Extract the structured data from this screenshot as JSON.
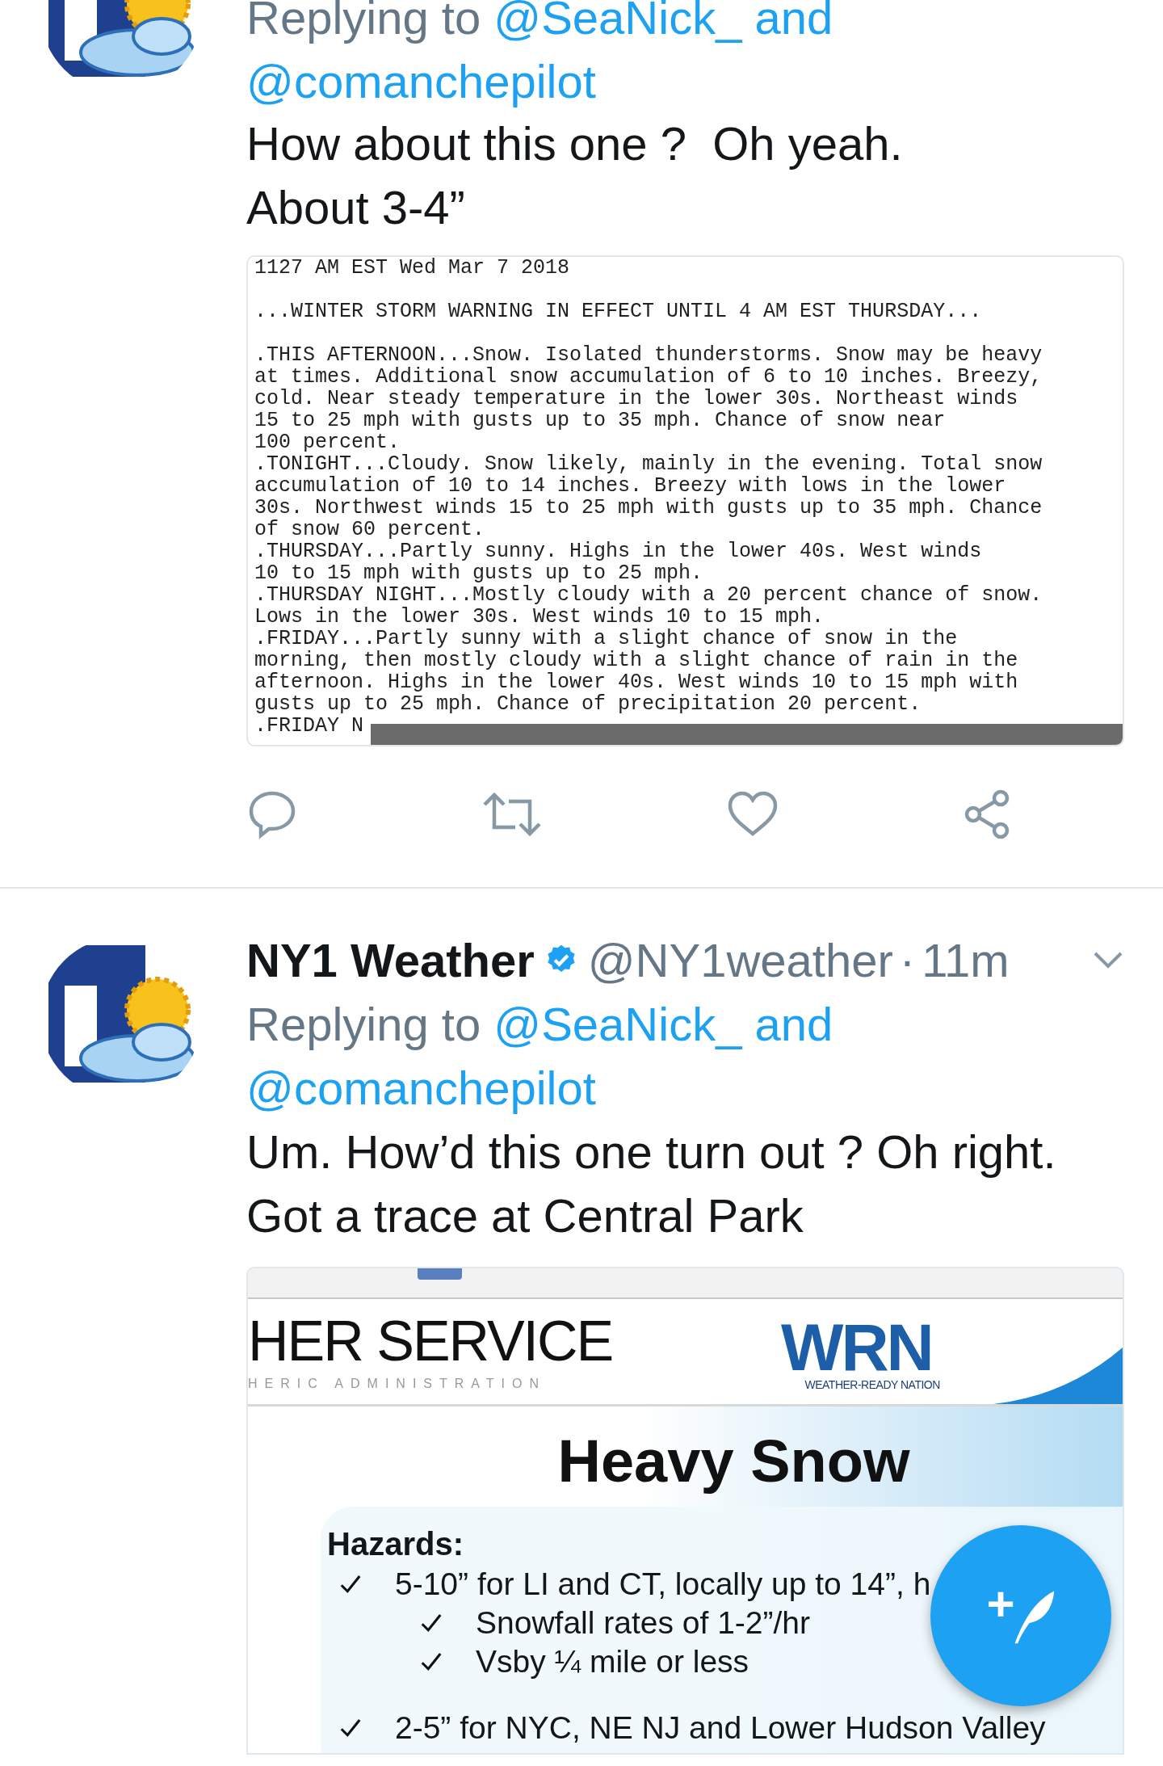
{
  "tweets": [
    {
      "reply": {
        "prefix": "Replying to",
        "mentions": [
          "@SeaNick_ and",
          "@comanchepilot"
        ]
      },
      "text": "How about this one ?  Oh yeah. About 3-4”",
      "attachment": {
        "kind": "document",
        "paragraphs": [
          [
            "1127 AM EST Wed Mar 7 2018"
          ],
          [
            "...WINTER STORM WARNING IN EFFECT UNTIL 4 AM EST THURSDAY..."
          ],
          [
            ".THIS AFTERNOON...Snow. Isolated thunderstorms. Snow may be heavy",
            "at times. Additional snow accumulation of 6 to 10 inches. Breezy,",
            "cold. Near steady temperature in the lower 30s. Northeast winds",
            "15 to 25 mph with gusts up to 35 mph. Chance of snow near",
            "100 percent.",
            ".TONIGHT...Cloudy. Snow likely, mainly in the evening. Total snow",
            "accumulation of 10 to 14 inches. Breezy with lows in the lower",
            "30s. Northwest winds 15 to 25 mph with gusts up to 35 mph. Chance",
            "of snow 60 percent.",
            ".THURSDAY...Partly sunny. Highs in the lower 40s. West winds",
            "10 to 15 mph with gusts up to 25 mph.",
            ".THURSDAY NIGHT...Mostly cloudy with a 20 percent chance of snow.",
            "Lows in the lower 30s. West winds 10 to 15 mph.",
            ".FRIDAY...Partly sunny with a slight chance of snow in the",
            "morning, then mostly cloudy with a slight chance of rain in the",
            "afternoon. Highs in the lower 40s. West winds 10 to 15 mph with",
            "gusts up to 25 mph. Chance of precipitation 20 percent.",
            ".FRIDAY N"
          ]
        ]
      },
      "actions": [
        {
          "kind": "reply"
        },
        {
          "kind": "retweet"
        },
        {
          "kind": "like"
        },
        {
          "kind": "share"
        }
      ]
    },
    {
      "author": {
        "name": "NY1 Weather",
        "verified": true,
        "handle": "@NY1weather",
        "separator": "·",
        "time": "11m"
      },
      "reply": {
        "prefix": "Replying to",
        "mentions": [
          "@SeaNick_ and",
          "@comanchepilot"
        ]
      },
      "text": "Um. How’d this one turn out ? Oh right. Got a trace at Central Park",
      "attachment": {
        "kind": "slide",
        "agency": "HER SERVICE",
        "agency_sub": "HERIC ADMINISTRATION",
        "logo": "WRN",
        "logo_caption": "WEATHER-READY NATION",
        "title": "Heavy Snow",
        "section": "Hazards:",
        "items": [
          {
            "text": "5-10” for LI and CT, locally up to 14”, h",
            "children": [
              {
                "text": "Snowfall rates of 1-2”/hr"
              },
              {
                "text": "Vsby ¼ mile or less"
              }
            ]
          },
          {
            "text": "2-5” for NYC, NE NJ and Lower Hudson Valley"
          }
        ]
      }
    }
  ],
  "compose_button": {
    "label": "+"
  }
}
